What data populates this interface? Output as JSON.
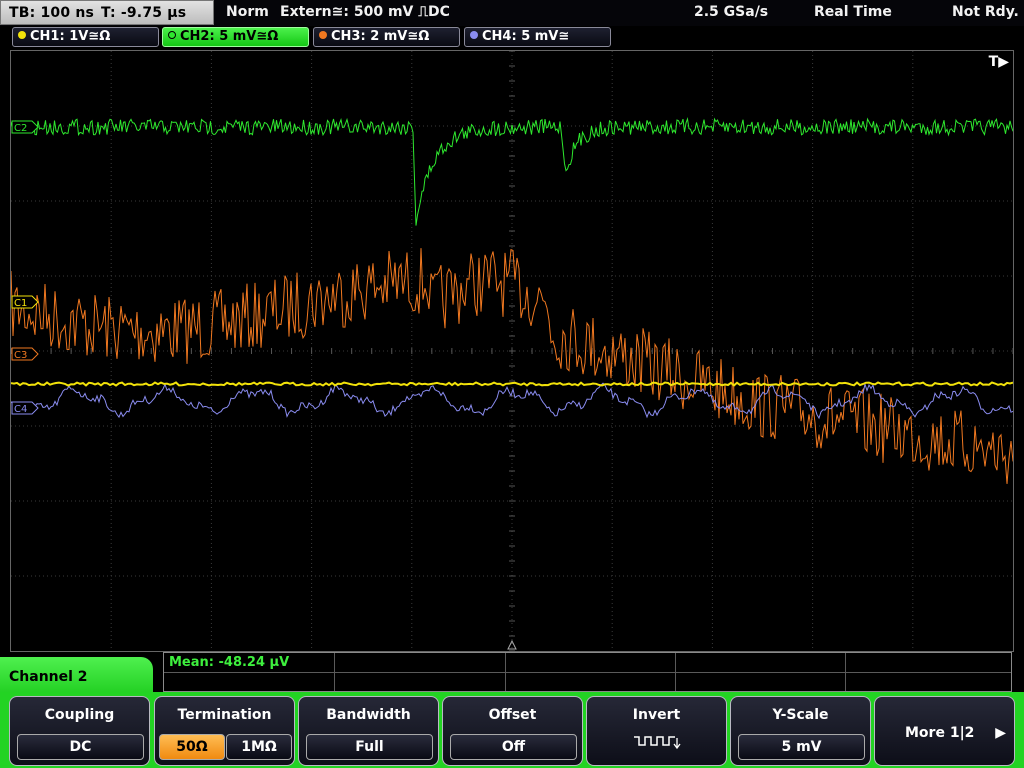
{
  "status_bar": {
    "timebase": "TB: 100 ns",
    "trigger_time": "T: -9.75 µs",
    "trigger_mode": "Norm",
    "trigger_source": "Extern≅: 500 mV ⎍DC",
    "sample_rate": "2.5 GSa/s",
    "acq_mode": "Real Time",
    "acq_state": "Not Rdy."
  },
  "channels": [
    {
      "label": "CH1: 1V≅Ω",
      "color": "#f2e20a",
      "active": false
    },
    {
      "label": "CH2: 5 mV≅Ω",
      "color": "#2ee82e",
      "active": true
    },
    {
      "label": "CH3: 2 mV≅Ω",
      "color": "#f07820",
      "active": false
    },
    {
      "label": "CH4: 5 mV≅",
      "color": "#8a8cf0",
      "active": false
    }
  ],
  "waveform_labels": {
    "c1": "C1",
    "c2": "C2",
    "c3": "C3",
    "c4": "C4",
    "trigger_flag": "T▶"
  },
  "measurement": {
    "value": "Mean: -48.24 µV"
  },
  "menu": {
    "title": "Channel 2",
    "coupling": {
      "label": "Coupling",
      "value": "DC"
    },
    "termination": {
      "label": "Termination",
      "opt1": "50Ω",
      "opt2": "1MΩ",
      "selected": "50Ω"
    },
    "bandwidth": {
      "label": "Bandwidth",
      "value": "Full"
    },
    "offset": {
      "label": "Offset",
      "value": "Off"
    },
    "invert": {
      "label": "Invert",
      "icon": "invert-square-wave-icon"
    },
    "yscale": {
      "label": "Y-Scale",
      "value": "5 mV"
    },
    "more": {
      "label": "More 1|2",
      "icon": "arrow-right-icon"
    }
  },
  "colors": {
    "ch1": "#f2e20a",
    "ch2": "#2ee82e",
    "ch3": "#f07820",
    "ch4": "#8a8cf0",
    "menu_green": "#23d323",
    "selected_option": "#f5a030"
  }
}
